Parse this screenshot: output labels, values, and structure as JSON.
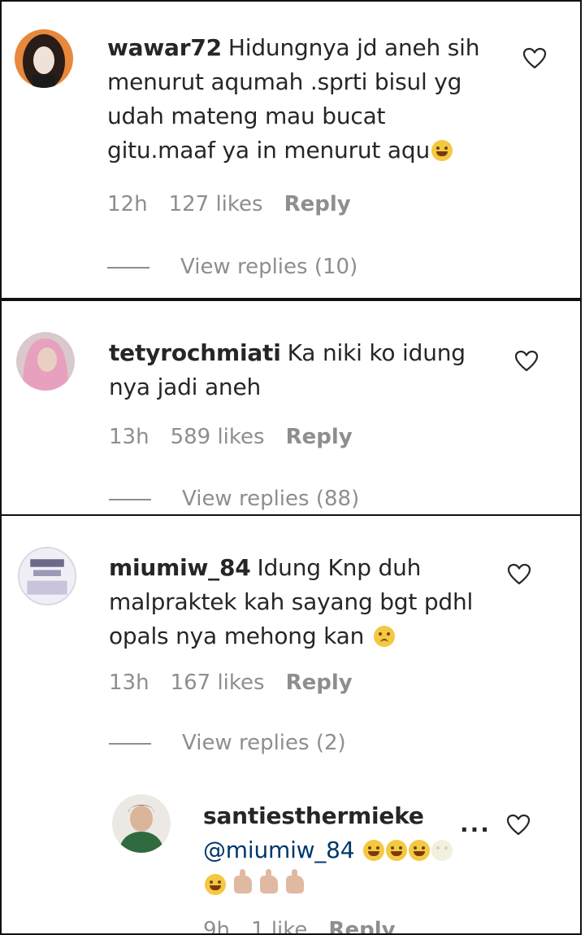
{
  "comments": [
    {
      "username": "wawar72",
      "lines": [
        "Hidungnya jd aneh sih",
        "menurut aqumah .sprti bisul yg",
        "udah mateng mau bucat",
        "gitu.maaf ya in menurut aqu"
      ],
      "time": "12h",
      "likes": "127 likes",
      "reply_label": "Reply",
      "view_replies": "View replies (10)"
    },
    {
      "username": "tetyrochmiati",
      "lines": [
        "Ka niki ko idung",
        "nya jadi aneh"
      ],
      "time": "13h",
      "likes": "589 likes",
      "reply_label": "Reply",
      "view_replies": "View replies (88)"
    },
    {
      "username": "miumiw_84",
      "lines": [
        "Idung Knp duh",
        "malpraktek kah sayang bgt pdhl",
        "opals nya mehong kan"
      ],
      "time": "13h",
      "likes": "167 likes",
      "reply_label": "Reply",
      "view_replies": "View replies (2)"
    }
  ],
  "reply": {
    "username": "santiesthermieke",
    "mention": "@miumiw_84",
    "more": "...",
    "time": "9h",
    "likes": "1 like",
    "reply_label": "Reply"
  },
  "icons": {
    "like": "heart-outline-icon",
    "more": "more-horizontal-icon",
    "emoji": "face-emoji"
  },
  "colors": {
    "text": "#262626",
    "secondary": "#8e8e8e",
    "mention": "#00376b",
    "border": "#111111"
  }
}
